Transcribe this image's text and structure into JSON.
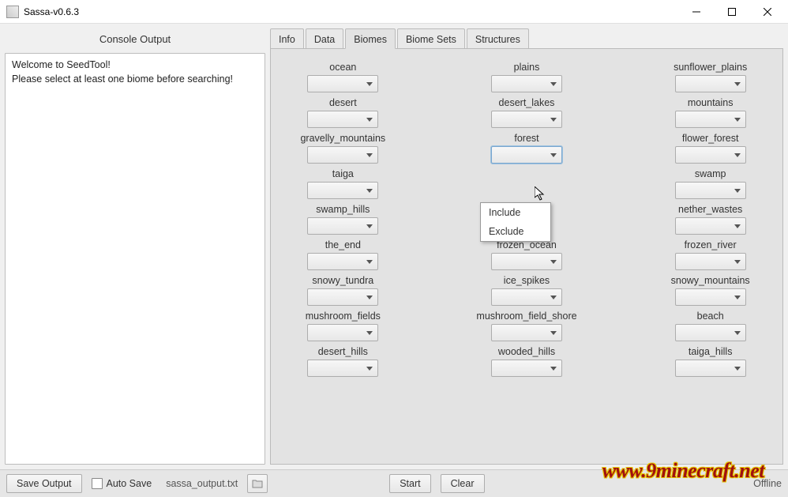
{
  "window": {
    "title": "Sassa-v0.6.3"
  },
  "tabs": [
    "Info",
    "Data",
    "Biomes",
    "Biome Sets",
    "Structures"
  ],
  "active_tab": "Biomes",
  "console": {
    "header": "Console Output",
    "lines": [
      "Welcome to SeedTool!",
      "Please select at least one biome before searching!"
    ]
  },
  "biomes": [
    {
      "label": "ocean"
    },
    {
      "label": "plains"
    },
    {
      "label": "sunflower_plains"
    },
    {
      "label": "desert"
    },
    {
      "label": "desert_lakes"
    },
    {
      "label": "mountains"
    },
    {
      "label": "gravelly_mountains"
    },
    {
      "label": "forest",
      "open": true
    },
    {
      "label": "flower_forest"
    },
    {
      "label": "taiga"
    },
    {
      "label": "",
      "hidden": true
    },
    {
      "label": "swamp"
    },
    {
      "label": "swamp_hills"
    },
    {
      "label": "",
      "hidden": true
    },
    {
      "label": "nether_wastes"
    },
    {
      "label": "the_end"
    },
    {
      "label": "frozen_ocean"
    },
    {
      "label": "frozen_river"
    },
    {
      "label": "snowy_tundra"
    },
    {
      "label": "ice_spikes"
    },
    {
      "label": "snowy_mountains"
    },
    {
      "label": "mushroom_fields"
    },
    {
      "label": "mushroom_field_shore"
    },
    {
      "label": "beach"
    },
    {
      "label": "desert_hills"
    },
    {
      "label": "wooded_hills"
    },
    {
      "label": "taiga_hills"
    }
  ],
  "dropdown_options": [
    "Include",
    "Exclude"
  ],
  "bottom": {
    "save": "Save Output",
    "autosave": "Auto Save",
    "filename": "sassa_output.txt",
    "start": "Start",
    "clear": "Clear",
    "status": "Offline"
  },
  "watermark": "www.9minecraft.net"
}
